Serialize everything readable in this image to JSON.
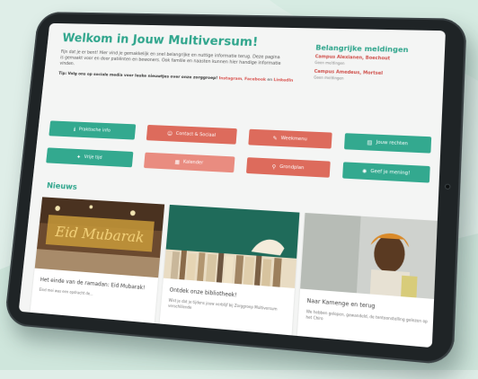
{
  "page": {
    "title": "Welkom in Jouw Multiversum!",
    "intro": "Fijn dat je er bent! Hier vind je gemakkelijk en snel belangrijke en nuttige informatie terug. Deze pagina is gemaakt voor en door patiënten en bewoners. Ook familie en naasten kunnen hier handige informatie vinden.",
    "tip_prefix": "Tip: Volg ons op sociale media voor leuke nieuwtjes over onze zorggroep!",
    "tip_links": [
      "Instagram",
      "Facebook",
      "LinkedIn"
    ],
    "tip_and": "en",
    "tip_comma": ","
  },
  "sidebar": {
    "title": "Belangrijke meldingen",
    "notices": [
      {
        "title": "Campus Alexianen, Boechout",
        "sub": "Geen meldingen"
      },
      {
        "title": "Campus Amedeus, Mortsel",
        "sub": "Geen meldingen"
      }
    ]
  },
  "buttons": [
    {
      "label": "Praktische info",
      "icon": "info-icon",
      "glyph": "ℹ",
      "color": "#33a98f"
    },
    {
      "label": "Contact & Sociaal",
      "icon": "people-icon",
      "glyph": "☺",
      "color": "#dd6b5c"
    },
    {
      "label": "Weekmenu",
      "icon": "cutlery-icon",
      "glyph": "✎",
      "color": "#dd6b5c"
    },
    {
      "label": "Jouw rechten",
      "icon": "rights-icon",
      "glyph": "▤",
      "color": "#33a98f"
    },
    {
      "label": "Vrije tijd",
      "icon": "walking-icon",
      "glyph": "✦",
      "color": "#33a98f"
    },
    {
      "label": "Kalender",
      "icon": "calendar-icon",
      "glyph": "▦",
      "color": "#e98c80"
    },
    {
      "label": "Grondplan",
      "icon": "map-pin-icon",
      "glyph": "⚲",
      "color": "#dd6b5c"
    },
    {
      "label": "Geef je mening!",
      "icon": "lightbulb-icon",
      "glyph": "✺",
      "color": "#33a98f"
    }
  ],
  "news": {
    "title": "Nieuws",
    "cards": [
      {
        "title": "Het einde van de ramadan: Eid Mubarak!",
        "text": "Eind mei was een opdracht de...",
        "image": "eid-mubarak-sign"
      },
      {
        "title": "Ontdek onze bibliotheek!",
        "text": "Wist je dat je tijdens jouw verblijf bij Zorggroep Multiversum verschillende",
        "image": "books-on-shelf"
      },
      {
        "title": "Naar Kamenge en terug",
        "text": "We hebben gelopen, gewandeld, de tentoonstelling gelezen op het Chiro",
        "image": "child-portrait"
      }
    ]
  },
  "colors": {
    "teal": "#33a98f",
    "red": "#dd6b5c",
    "heading_green": "#2fa58c"
  }
}
